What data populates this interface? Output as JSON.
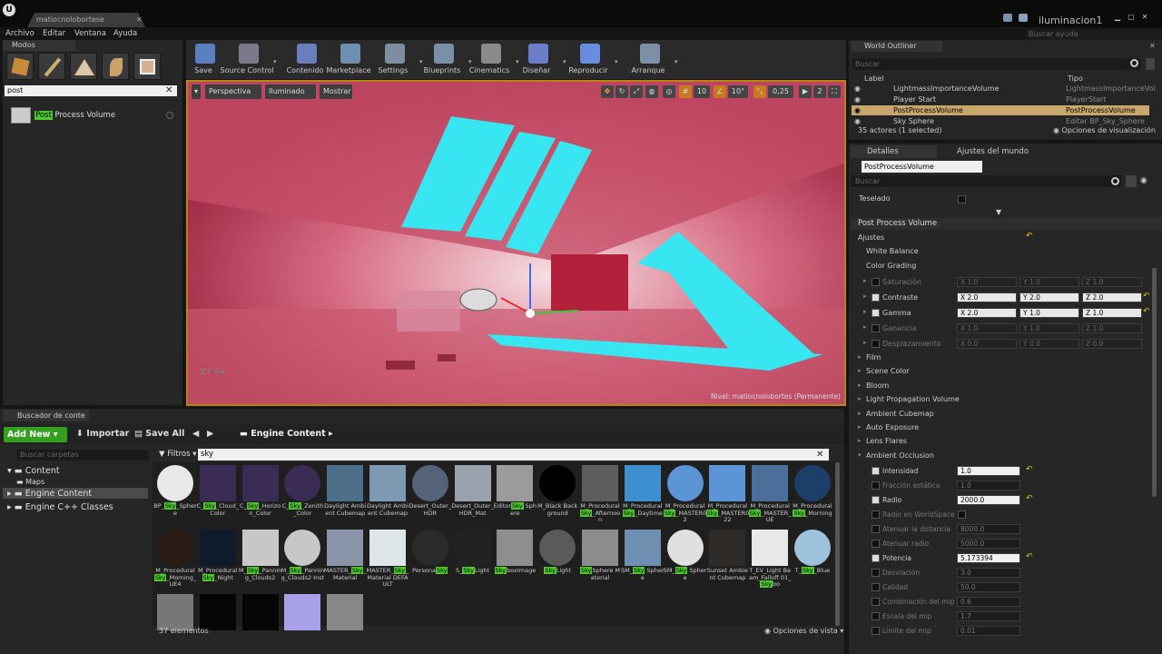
{
  "title_bar": {
    "doc_tab": "matiocnolobortese",
    "project_name": "iluminacion1",
    "search_help_placeholder": "Buscar ayuda"
  },
  "menu": [
    "Archivo",
    "Editar",
    "Ventana",
    "Ayuda"
  ],
  "modes": {
    "tab": "Modos",
    "search_value": "post",
    "result_highlight": "Post",
    "result_rest": " Process Volume"
  },
  "toolbar": [
    {
      "label": "Save",
      "icon": "save-icon",
      "color": "#5b7fc0"
    },
    {
      "label": "Source Control",
      "icon": "source-control-icon",
      "color": "#7a7a8a"
    },
    {
      "label": "Contenido",
      "icon": "content-icon",
      "color": "#6b7fbf"
    },
    {
      "label": "Marketplace",
      "icon": "marketplace-icon",
      "color": "#6d8fb0"
    },
    {
      "label": "Settings",
      "icon": "settings-icon",
      "color": "#7f8da0"
    },
    {
      "label": "Blueprints",
      "icon": "blueprints-icon",
      "color": "#7b8fa8"
    },
    {
      "label": "Cinematics",
      "icon": "cinematics-icon",
      "color": "#8a8a8a"
    },
    {
      "label": "Diseñar",
      "icon": "build-icon",
      "color": "#6c7ec8"
    },
    {
      "label": "Reproducir",
      "icon": "play-icon",
      "color": "#6a8cdd"
    },
    {
      "label": "Arranque",
      "icon": "launch-icon",
      "color": "#7d90a8"
    }
  ],
  "viewport": {
    "perspective": "Perspectiva",
    "lit": "Iluminado",
    "show": "Mostrar",
    "grid_snap": "10",
    "rot_snap": "10°",
    "scale_snap": "0,25",
    "camera_speed": "2",
    "level_label": "Nivel:  matiocnolobortes (Permanente)",
    "accent": "#ff7d1a"
  },
  "outliner": {
    "tab": "World Outliner",
    "search_placeholder": "Buscar",
    "col_label": "Label",
    "col_type": "Tipo",
    "rows": [
      {
        "label": "LightmassImportanceVolume",
        "type": "LightmassImportanceVol",
        "selected": false
      },
      {
        "label": "Player Start",
        "type": "PlayerStart",
        "selected": false
      },
      {
        "label": "PostProcessVolume",
        "type": "PostProcessVolume",
        "selected": true
      },
      {
        "label": "Sky Sphere",
        "type": "Editar BP_Sky_Sphere",
        "selected": false
      }
    ],
    "count": "35 actores (1 selected)",
    "view_options": "Opciones de visualización"
  },
  "details": {
    "tab": "Detalles",
    "tab_world": "Ajustes del mundo",
    "name": "PostProcessVolume",
    "search_placeholder": "Buscar",
    "teselado": "Teselado",
    "section": "Post Process Volume",
    "ajustes": "Ajustes",
    "white_balance": "White Balance",
    "color_grading": "Color Grading",
    "cg_props": [
      {
        "name": "Saturación",
        "x": "X 1.0",
        "y": "Y 1.0",
        "z": "Z 1.0",
        "on": false
      },
      {
        "name": "Contraste",
        "x": "X 2.0",
        "y": "Y 2.0",
        "z": "Z 2.0",
        "on": true
      },
      {
        "name": "Gamma",
        "x": "X 2.0",
        "y": "Y 1.0",
        "z": "Z 1.0",
        "on": true
      },
      {
        "name": "Ganancia",
        "x": "X 1.0",
        "y": "Y 1.0",
        "z": "Z 1.0",
        "on": false
      },
      {
        "name": "Desplazamiento",
        "x": "X 0.0",
        "y": "Y 0.0",
        "z": "Z 0.0",
        "on": false
      }
    ],
    "groups": [
      "Film",
      "Scene Color",
      "Bloom",
      "Light Propagation Volume",
      "Ambient Cubemap",
      "Auto Exposure",
      "Lens Flares",
      "Ambient Occlusion"
    ],
    "ao_props": [
      {
        "name": "Intensidad",
        "value": "1.0",
        "on": true
      },
      {
        "name": "Fracción estática",
        "value": "1.0",
        "on": false
      },
      {
        "name": "Radio",
        "value": "2000.0",
        "on": true
      },
      {
        "name": "Radio en WorldSpace",
        "value": "",
        "on": false
      },
      {
        "name": "Atenuar la distancia",
        "value": "8000.0",
        "on": false
      },
      {
        "name": "Atenuar radio",
        "value": "5000.0",
        "on": false
      },
      {
        "name": "Potencia",
        "value": "5.173394",
        "on": true
      },
      {
        "name": "Desviación",
        "value": "3.0",
        "on": false
      },
      {
        "name": "Calidad",
        "value": "50.0",
        "on": false
      },
      {
        "name": "Combinación del mip",
        "value": "0.6",
        "on": false
      },
      {
        "name": "Escala del mip",
        "value": "1.7",
        "on": false
      },
      {
        "name": "Límite del mip",
        "value": "0.01",
        "on": false
      }
    ]
  },
  "content_browser": {
    "tab": "Buscador de conte",
    "add_new": "Add New",
    "import": "Importar",
    "save_all": "Save All",
    "path": "Engine Content",
    "folder_search": "Buscar carpetas",
    "tree": [
      "Content",
      "Maps",
      "Engine Content",
      "Engine C++ Classes"
    ],
    "filters": "Filtros",
    "search_value": "sky",
    "count": "37 elementos",
    "view_options": "Opciones de vista"
  },
  "assets_row1": [
    {
      "label": "BP_Sky_Sphere",
      "color": "#e8e8e8"
    },
    {
      "label": "C_Sky_Cloud_Color",
      "color": "#3a2c55"
    },
    {
      "label": "C_Sky_Horizon_Color",
      "color": "#3a2c55"
    },
    {
      "label": "C_Sky_Zenith_Color",
      "color": "#3a2c55"
    },
    {
      "label": "Daylight Ambient Cubemap",
      "color": "#4e6f8a"
    },
    {
      "label": "Daylight Ambient Cubemap",
      "color": "#7d9ab2"
    },
    {
      "label": "Desert_Outer_HDR",
      "color": "#55637a"
    },
    {
      "label": "Desert_Outer_HDR_Mat",
      "color": "#9aa2ad"
    },
    {
      "label": "EditorSky Sphere",
      "color": "#9b9b9b"
    },
    {
      "label": "M_Black Background",
      "color": "#000000"
    },
    {
      "label": "M_Procedural Sky_Afternoon",
      "color": "#5d5d5d"
    },
    {
      "label": "M_Procedural Sky_Daytime",
      "color": "#3e8fd0"
    },
    {
      "label": "M_Procedural Sky_MASTER02",
      "color": "#5c95d6"
    },
    {
      "label": "M_Procedural Sky_MASTER022",
      "color": "#5c95d6"
    },
    {
      "label": "M_Procedural Sky_MASTER_UE",
      "color": "#4b6f9a"
    },
    {
      "label": "M_Procedural Sky_Morning",
      "color": "#1e3e6a"
    }
  ],
  "assets_row2": [
    {
      "label": "M_Procedural Sky_Morning_UE4",
      "color": "#2a1c14"
    },
    {
      "label": "M_Procedural Sky_Night",
      "color": "#0f1a2a"
    },
    {
      "label": "M_Sky_Panning_Clouds2",
      "color": "#c7c7c7"
    },
    {
      "label": "M_Sky_Panning_Clouds2 Inst",
      "color": "#c7c7c7"
    },
    {
      "label": "MASTER_Sky_Material",
      "color": "#8a94a8"
    },
    {
      "label": "MASTER_Sky_Material DEFAULT",
      "color": "#dfe6ea"
    },
    {
      "label": "PersonaSky",
      "color": "#2b2b2b"
    },
    {
      "label": "S_SkyLight",
      "color": "#222222"
    },
    {
      "label": "SkyboxImage",
      "color": "#8e8e8e"
    },
    {
      "label": "SkyLight",
      "color": "#5a5a5a"
    },
    {
      "label": "SkySphere Material",
      "color": "#8c8c8c"
    },
    {
      "label": "SM_Sky Sphere",
      "color": "#6f8fb0"
    },
    {
      "label": "SM_Sky Sphere",
      "color": "#e0e0e0"
    },
    {
      "label": "Sunset Ambient Cubemap",
      "color": "#2e2a28"
    },
    {
      "label": "T_EV_Light Beam_Falloff 01_Skybo",
      "color": "#e8e8e8"
    },
    {
      "label": "T_Sky_Blue",
      "color": "#9fc2dc"
    }
  ],
  "assets_row3": [
    {
      "label": "",
      "color": "#777777"
    },
    {
      "label": "",
      "color": "#050505"
    },
    {
      "label": "",
      "color": "#050505"
    },
    {
      "label": "",
      "color": "#a8a0e8"
    },
    {
      "label": "",
      "color": "#888888"
    }
  ]
}
